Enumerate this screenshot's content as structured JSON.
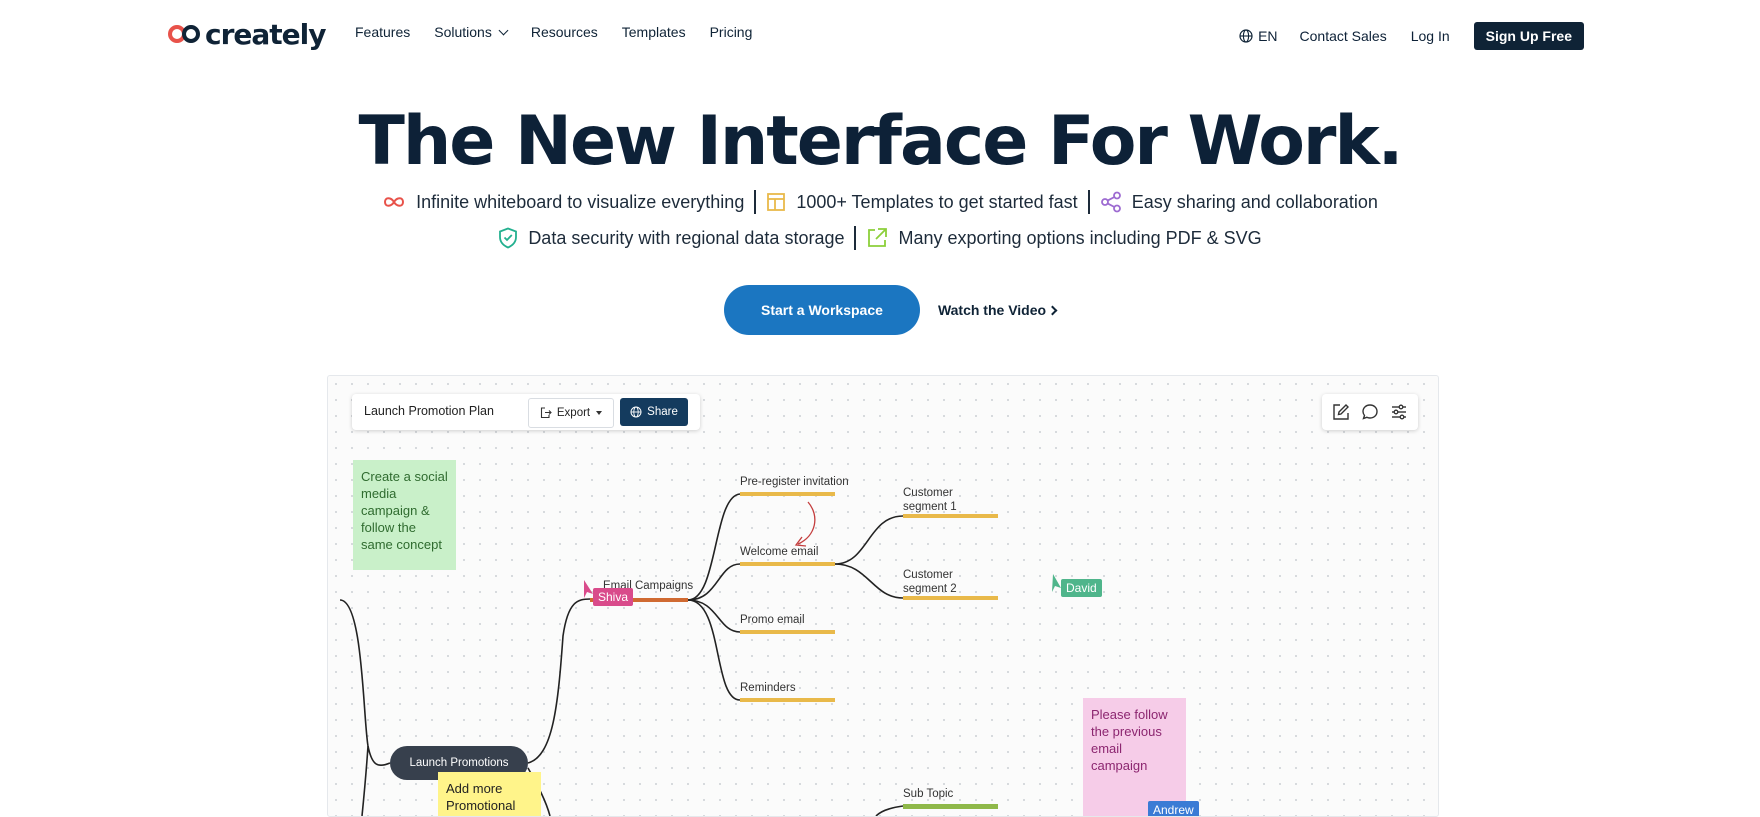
{
  "nav": {
    "logo_text": "creately",
    "links": [
      "Features",
      "Solutions",
      "Resources",
      "Templates",
      "Pricing"
    ],
    "lang": "EN",
    "contact": "Contact Sales",
    "login": "Log In",
    "signup": "Sign Up Free"
  },
  "hero": {
    "title": "The New Interface For Work.",
    "features_row1": [
      {
        "icon": "infinity-icon",
        "text": "Infinite whiteboard to visualize everything"
      },
      {
        "icon": "templates-icon",
        "text": "1000+ Templates to get started fast"
      },
      {
        "icon": "share-nodes-icon",
        "text": "Easy sharing and collaboration"
      }
    ],
    "features_row2": [
      {
        "icon": "shield-check-icon",
        "text": "Data security with regional data storage"
      },
      {
        "icon": "export-icon",
        "text": "Many exporting options including PDF & SVG"
      }
    ],
    "cta_primary": "Start a Workspace",
    "cta_secondary": "Watch the Video"
  },
  "canvas": {
    "doc_title": "Launch Promotion Plan",
    "export_label": "Export",
    "share_label": "Share",
    "sticky_green": "Create a social media campaign & follow the same concept",
    "sticky_pink": "Please follow the previous email campaign",
    "sticky_yellow": "Add more Promotional",
    "main_node": "Launch Promotions",
    "email_campaigns": "Email Campaigns",
    "pre_register": "Pre-register invitation",
    "welcome_email": "Welcome email",
    "promo_email": "Promo email",
    "reminders": "Reminders",
    "segment1": "Customer segment 1",
    "segment2": "Customer segment 2",
    "sub_topic": "Sub Topic",
    "cursor_shiva": "Shiva",
    "cursor_david": "David",
    "cursor_andrew": "Andrew"
  },
  "colors": {
    "brand_dark": "#0f2336",
    "cta_blue": "#1b76c1",
    "branch_orange": "#d06a32",
    "branch_yellow": "#e9b94a",
    "branch_green": "#8fb84a"
  }
}
